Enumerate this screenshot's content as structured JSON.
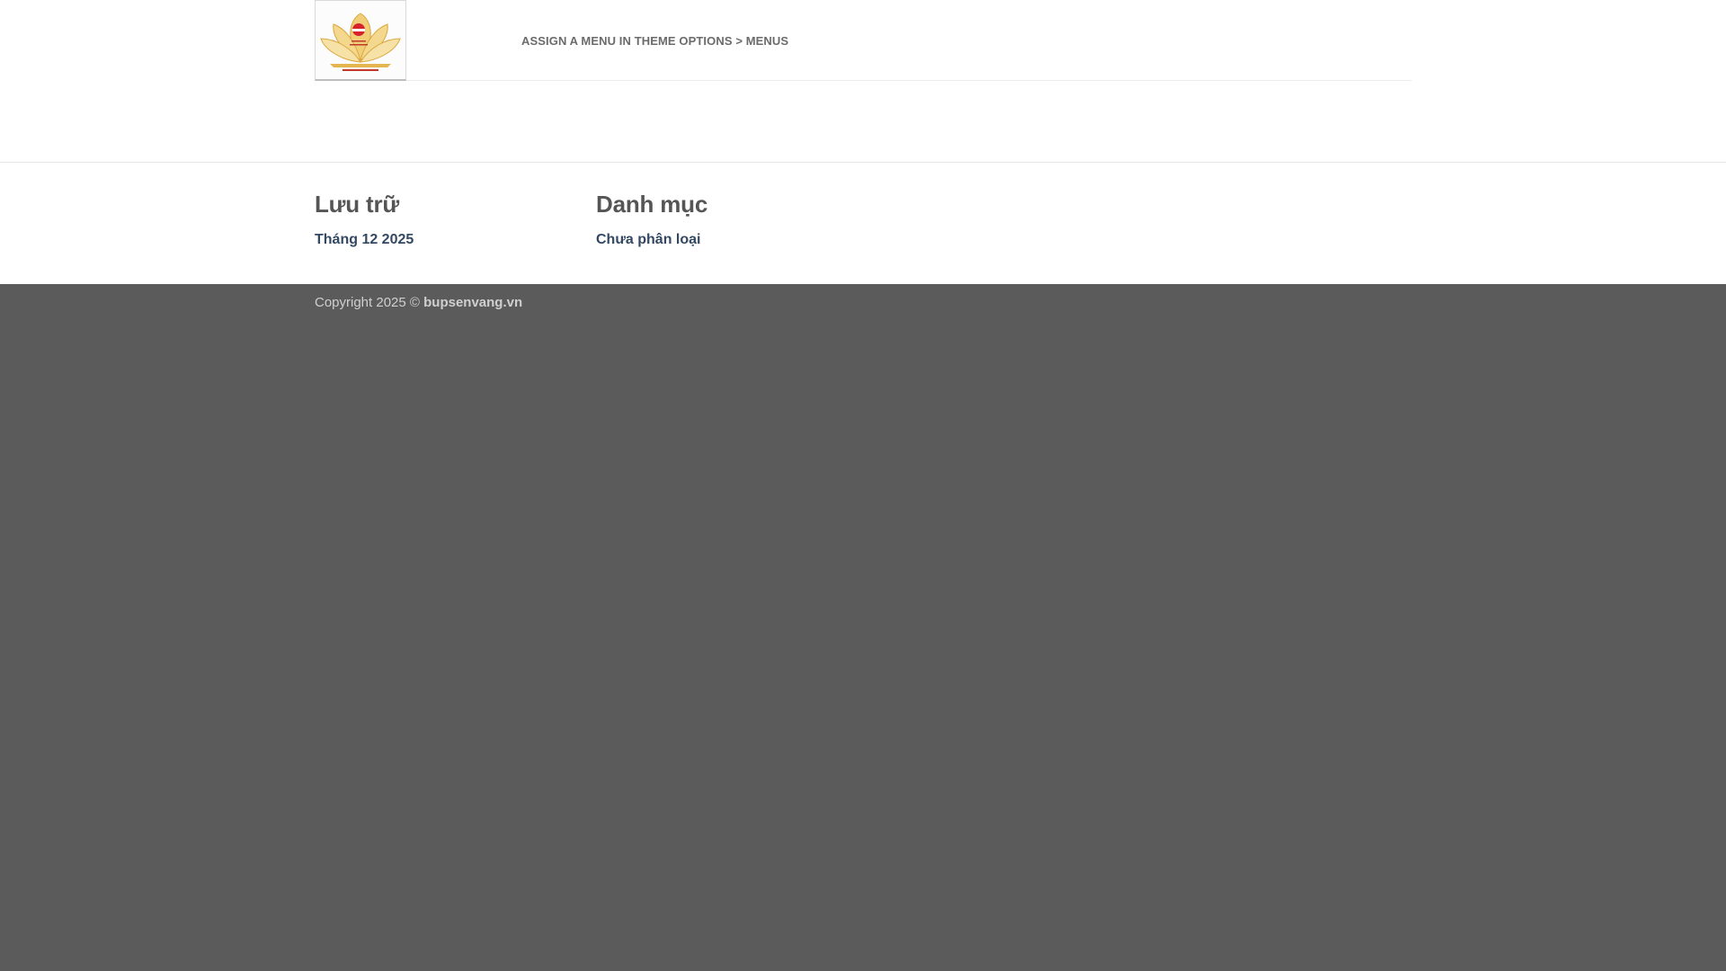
{
  "header": {
    "logo_alt": "bupsenvang.vn",
    "nav_notice": "ASSIGN A MENU IN THEME OPTIONS > MENUS"
  },
  "widgets": {
    "archive": {
      "title": "Lưu trữ",
      "items": [
        "Tháng 12 2025"
      ]
    },
    "category": {
      "title": "Danh mục",
      "items": [
        "Chưa phân loại"
      ]
    }
  },
  "footer": {
    "copyright_prefix": "Copyright 2025 ©",
    "copyright_site": "bupsenvang.vn"
  },
  "colors": {
    "footer_bg": "#5b5b5b",
    "link": "#334862",
    "heading": "#555555",
    "logo_red": "#d8232a",
    "logo_gold": "#e3b64f"
  }
}
